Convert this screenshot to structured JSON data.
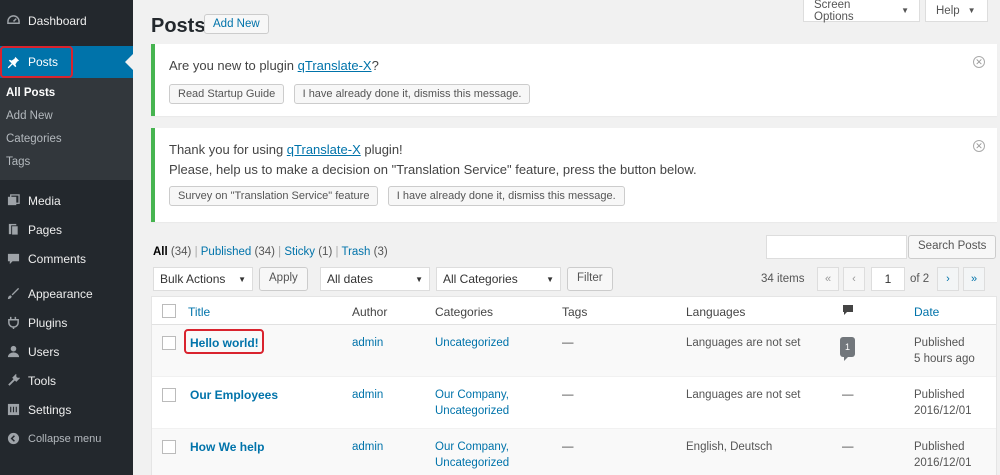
{
  "sidebar": {
    "items": [
      {
        "label": "Dashboard",
        "icon": "dashboard-icon"
      },
      {
        "label": "Posts",
        "icon": "pin-icon"
      },
      {
        "label": "Media",
        "icon": "media-icon"
      },
      {
        "label": "Pages",
        "icon": "pages-icon"
      },
      {
        "label": "Comments",
        "icon": "comments-icon"
      },
      {
        "label": "Appearance",
        "icon": "appearance-icon"
      },
      {
        "label": "Plugins",
        "icon": "plugins-icon"
      },
      {
        "label": "Users",
        "icon": "users-icon"
      },
      {
        "label": "Tools",
        "icon": "tools-icon"
      },
      {
        "label": "Settings",
        "icon": "settings-icon"
      },
      {
        "label": "Collapse menu",
        "icon": "collapse-icon"
      }
    ],
    "submenu": [
      "All Posts",
      "Add New",
      "Categories",
      "Tags"
    ]
  },
  "top": {
    "screen_options": "Screen Options",
    "help": "Help"
  },
  "header": {
    "title": "Posts",
    "add_new": "Add New"
  },
  "notice1": {
    "text_before": "Are you new to plugin ",
    "link": "qTranslate-X",
    "text_after": "?",
    "btn1": "Read Startup Guide",
    "btn2": "I have already done it, dismiss this message."
  },
  "notice2": {
    "text_before": "Thank you for using ",
    "link": "qTranslate-X",
    "text_after": " plugin!",
    "line2": "Please, help us to make a decision on \"Translation Service\" feature, press the button below.",
    "btn1": "Survey on \"Translation Service\" feature",
    "btn2": "I have already done it, dismiss this message."
  },
  "filters": {
    "all": "All",
    "all_count": "(34)",
    "published": "Published",
    "published_count": "(34)",
    "sticky": "Sticky",
    "sticky_count": "(1)",
    "trash": "Trash",
    "trash_count": "(3)",
    "sep": "|",
    "search_button": "Search Posts",
    "bulk_actions": "Bulk Actions",
    "apply": "Apply",
    "all_dates": "All dates",
    "all_categories": "All Categories",
    "filter": "Filter",
    "items": "34 items",
    "page": "1",
    "of_pages": "of 2",
    "first": "«",
    "prev": "‹",
    "next": "›",
    "last": "»"
  },
  "table": {
    "headers": {
      "title": "Title",
      "author": "Author",
      "categories": "Categories",
      "tags": "Tags",
      "languages": "Languages",
      "date": "Date"
    },
    "rows": [
      {
        "title": "Hello world!",
        "author": "admin",
        "categories": "Uncategorized",
        "tags": "—",
        "languages": "Languages are not set",
        "comments": "1",
        "date1": "Published",
        "date2": "5 hours ago"
      },
      {
        "title": "Our Employees",
        "author": "admin",
        "categories": "Our Company, Uncategorized",
        "tags": "—",
        "languages": "Languages are not set",
        "comments": "—",
        "date1": "Published",
        "date2": "2016/12/01"
      },
      {
        "title": "How We help",
        "author": "admin",
        "categories": "Our Company, Uncategorized",
        "tags": "—",
        "languages": "English, Deutsch",
        "comments": "—",
        "date1": "Published",
        "date2": "2016/12/01"
      }
    ]
  },
  "colors": {
    "sidebar": "#23282d",
    "accent": "#0073aa",
    "highlight": "#d9232e",
    "notice_border": "#46b450"
  }
}
